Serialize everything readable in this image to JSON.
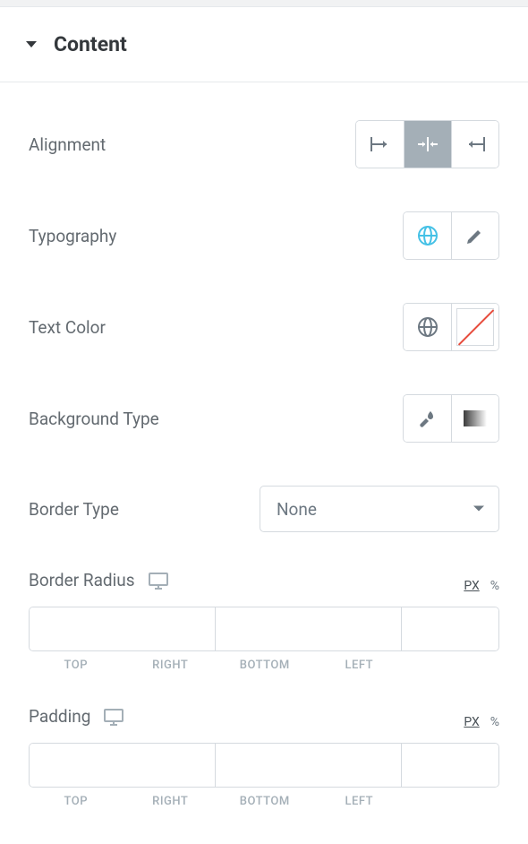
{
  "section": {
    "title": "Content"
  },
  "alignment": {
    "label": "Alignment",
    "value": "center"
  },
  "typography": {
    "label": "Typography"
  },
  "text_color": {
    "label": "Text Color"
  },
  "background_type": {
    "label": "Background Type"
  },
  "border_type": {
    "label": "Border Type",
    "value": "None"
  },
  "border_radius": {
    "label": "Border Radius",
    "unit_px": "PX",
    "unit_pct": "%",
    "sides": {
      "top": "TOP",
      "right": "RIGHT",
      "bottom": "BOTTOM",
      "left": "LEFT"
    }
  },
  "padding": {
    "label": "Padding",
    "unit_px": "PX",
    "unit_pct": "%",
    "sides": {
      "top": "TOP",
      "right": "RIGHT",
      "bottom": "BOTTOM",
      "left": "LEFT"
    }
  }
}
